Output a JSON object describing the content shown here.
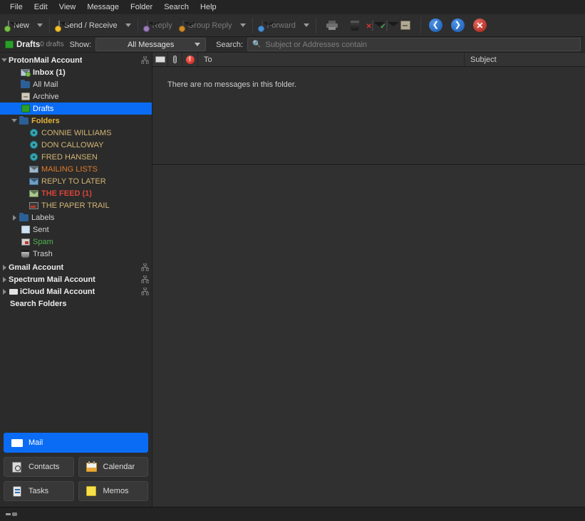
{
  "menubar": {
    "items": [
      {
        "label": "File"
      },
      {
        "label": "Edit"
      },
      {
        "label": "View"
      },
      {
        "label": "Message"
      },
      {
        "label": "Folder"
      },
      {
        "label": "Search"
      },
      {
        "label": "Help"
      }
    ]
  },
  "toolbar": {
    "new_label": "New",
    "send_receive_label": "Send / Receive",
    "reply_label": "Reply",
    "group_reply_label": "Group Reply",
    "forward_label": "Forward",
    "icons": {
      "new": "new-message-icon",
      "send_receive": "send-receive-icon",
      "reply": "reply-icon",
      "group_reply": "group-reply-icon",
      "forward": "forward-icon",
      "print": "print-icon",
      "delete": "trash-icon",
      "junk": "mark-junk-icon",
      "mark_read": "mark-read-icon",
      "archive": "archive-icon",
      "back": "back-arrow-icon",
      "next": "forward-arrow-icon",
      "stop": "stop-icon"
    }
  },
  "filterbar": {
    "folder_name": "Drafts",
    "count": "0 drafts",
    "show_label": "Show:",
    "show_value": "All Messages",
    "search_label": "Search:",
    "search_value": "",
    "search_placeholder": "Subject or Addresses contain"
  },
  "sidebar": {
    "accounts": [
      {
        "label": "ProtonMail Account",
        "expanded": true,
        "has_server_icon": true,
        "children": [
          {
            "label": "Inbox (1)",
            "icon": "inbox-icon",
            "indent": 2,
            "color": "#e8e8e8",
            "bold": true
          },
          {
            "label": "All Mail",
            "icon": "folder-icon",
            "indent": 2,
            "color": "#d2d2d2"
          },
          {
            "label": "Archive",
            "icon": "archive-icon",
            "indent": 2,
            "color": "#d2d2d2"
          },
          {
            "label": "Drafts",
            "icon": "drafts-icon",
            "indent": 2,
            "color": "#ffffff",
            "selected": true
          },
          {
            "label": "Folders",
            "icon": "folder-icon",
            "indent": 1,
            "color": "#e3b33a",
            "bold": true,
            "expanded": true
          },
          {
            "label": "CONNIE WILLIAMS",
            "icon": "contact-folder-icon",
            "indent": 3,
            "color": "#d2b474"
          },
          {
            "label": "DON CALLOWAY",
            "icon": "contact-folder-icon",
            "indent": 3,
            "color": "#d2b474"
          },
          {
            "label": "FRED HANSEN",
            "icon": "contact-folder-icon",
            "indent": 3,
            "color": "#d2b474"
          },
          {
            "label": "MAILING LISTS",
            "icon": "mail-folder-icon",
            "indent": 3,
            "color": "#e07b2a"
          },
          {
            "label": "REPLY TO LATER",
            "icon": "mail-folder-icon",
            "indent": 3,
            "color": "#d2b474"
          },
          {
            "label": "THE FEED (1)",
            "icon": "mail-folder-icon",
            "indent": 3,
            "color": "#d94438",
            "bold": true
          },
          {
            "label": "THE PAPER TRAIL",
            "icon": "tv-folder-icon",
            "indent": 3,
            "color": "#d2b474"
          },
          {
            "label": "Labels",
            "icon": "folder-icon",
            "indent": 2,
            "color": "#d2d2d2",
            "collapsed": true
          },
          {
            "label": "Sent",
            "icon": "sent-icon",
            "indent": 2,
            "color": "#d2d2d2"
          },
          {
            "label": "Spam",
            "icon": "spam-icon",
            "indent": 2,
            "color": "#4fb24f"
          },
          {
            "label": "Trash",
            "icon": "trash-icon",
            "indent": 2,
            "color": "#d2d2d2"
          }
        ]
      },
      {
        "label": "Gmail Account",
        "collapsed": true,
        "has_server_icon": true
      },
      {
        "label": "Spectrum Mail Account",
        "collapsed": true,
        "has_server_icon": true
      },
      {
        "label": "iCloud Mail Account",
        "collapsed": true,
        "has_server_icon": true,
        "has_env_icon": true
      },
      {
        "label": "Search Folders",
        "no_twisty": true
      }
    ]
  },
  "nav_buttons": [
    {
      "label": "Mail",
      "icon": "mail-icon",
      "active": true
    },
    {
      "label": "Contacts",
      "icon": "contacts-icon",
      "active": false
    },
    {
      "label": "Calendar",
      "icon": "calendar-icon",
      "active": false
    },
    {
      "label": "Tasks",
      "icon": "tasks-icon",
      "active": false
    },
    {
      "label": "Memos",
      "icon": "memos-icon",
      "active": false
    }
  ],
  "message_list": {
    "columns": [
      {
        "label": "",
        "icon": "read-status-icon"
      },
      {
        "label": "",
        "icon": "attachment-icon"
      },
      {
        "label": "",
        "icon": "importance-icon"
      },
      {
        "label": "To"
      },
      {
        "label": "Subject"
      }
    ],
    "rows": [],
    "empty_text": "There are no messages in this folder."
  },
  "statusbar": {
    "icon": "connection-icon",
    "text": ""
  },
  "colors": {
    "accent": "#0a6cf5",
    "background": "#2b2b2b",
    "toolbar": "#2e2e2e",
    "folder_yellow": "#e3b33a",
    "folder_tan": "#d2b474",
    "alert_red": "#d94438",
    "spam_green": "#4fb24f"
  }
}
